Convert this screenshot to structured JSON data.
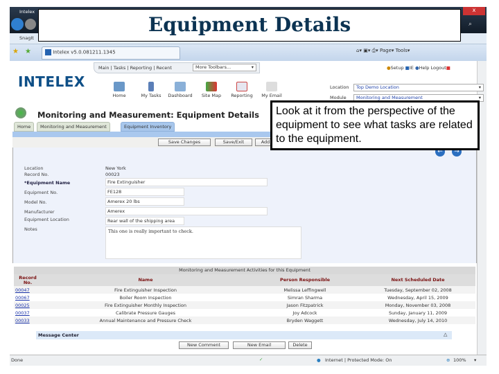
{
  "slide_title": "Equipment Details",
  "callout": "Look at it from the perspective of the equipment to see what tasks are related to the equipment.",
  "browser": {
    "window_title": "Intelex",
    "toolbar_label": "SnagIt",
    "tab_title": "Intelex v5.0.081211.1345",
    "commands": [
      "Page",
      "Tools"
    ],
    "status": "Done",
    "zone": "Internet | Protected Mode: On",
    "zoom": "100%"
  },
  "app": {
    "logo": "INTELEX",
    "nav_links": "Main | Tasks | Reporting | Recent",
    "more_toolbars": "More Toolbars...",
    "nav_icons": [
      "Home",
      "My Tasks",
      "Dashboard",
      "Site Map",
      "Reporting",
      "My Email"
    ],
    "right_links": [
      "Setup",
      "IE",
      "Help",
      "Logout"
    ],
    "location_label": "Location",
    "location_value": "Top Demo Location",
    "module_label": "Module",
    "module_value": "Monitoring and Measurement",
    "page_title": "Monitoring and Measurement:  Equipment Details",
    "tabs": [
      "Home",
      "Monitoring and Measurement",
      "Equipment Inventory"
    ],
    "buttons": [
      "Save Changes",
      "Save/Exit",
      "Add"
    ]
  },
  "form": {
    "location": {
      "label": "Location",
      "value": "New York"
    },
    "record": {
      "label": "Record No.",
      "value": "00023"
    },
    "name": {
      "label": "*Equipment Name",
      "value": "Fire Extinguisher"
    },
    "equip_no": {
      "label": "Equipment No.",
      "value": "FE128"
    },
    "model": {
      "label": "Model No.",
      "value": "Amerex 20 lbs"
    },
    "manufacturer": {
      "label": "Manufacturer",
      "value": "Amerex"
    },
    "equip_location": {
      "label": "Equipment Location",
      "value": "Rear wall of the shipping area"
    },
    "notes": {
      "label": "Notes",
      "value": "This one is really important to check."
    }
  },
  "activities": {
    "caption": "Monitoring and Measurement Activities for this Equipment",
    "headers": [
      "Record No.",
      "Name",
      "Person Responsible",
      "Next Scheduled Date"
    ],
    "rows": [
      [
        "00047",
        "Fire Extinguisher Inspection",
        "Melissa Leffingwell",
        "Tuesday, September 02, 2008"
      ],
      [
        "00067",
        "Boiler Room Inspection",
        "Simran Sharma",
        "Wednesday, April 15, 2009"
      ],
      [
        "00025",
        "Fire Extinguisher Monthly Inspection",
        "Jason Fitzpatrick",
        "Monday, November 03, 2008"
      ],
      [
        "00037",
        "Calibrate Pressure Gauges",
        "Joy Adcock",
        "Sunday, January 11, 2009"
      ],
      [
        "00033",
        "Annual Maintenance and Pressure Check",
        "Bryden Waggett",
        "Wednesday, July 14, 2010"
      ]
    ]
  },
  "message_center": {
    "title": "Message Center",
    "buttons": [
      "New Comment",
      "New Email",
      "Delete"
    ]
  }
}
